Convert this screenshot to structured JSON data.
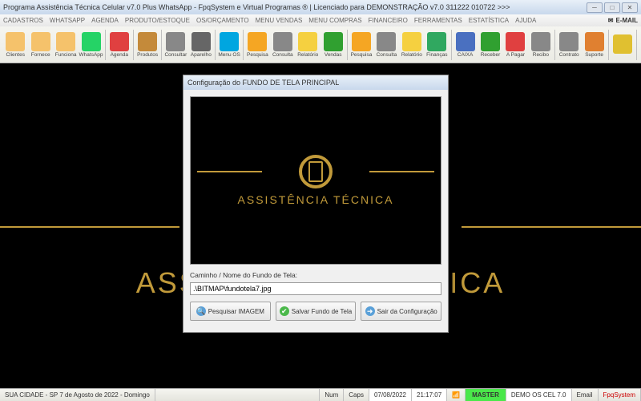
{
  "title": "Programa Assistência Técnica Celular v7.0 Plus WhatsApp - FpqSystem e Virtual Programas ® | Licenciado para  DEMONSTRAÇÃO v7.0 311222 010722  >>>",
  "menu": [
    "CADASTROS",
    "WHATSAPP",
    "AGENDA",
    "PRODUTO/ESTOQUE",
    "OS/ORÇAMENTO",
    "MENU VENDAS",
    "MENU COMPRAS",
    "FINANCEIRO",
    "FERRAMENTAS",
    "ESTATÍSTICA",
    "AJUDA"
  ],
  "email_label": "E-MAIL",
  "toolbar": [
    {
      "label": "Clientes",
      "name": "clientes",
      "color": "#f5c26b"
    },
    {
      "label": "Fornece",
      "name": "fornecedores",
      "color": "#f5c26b"
    },
    {
      "label": "Funciona",
      "name": "funcionarios",
      "color": "#f5c26b"
    },
    {
      "label": "WhatsApp",
      "name": "whatsapp",
      "color": "#25d366"
    },
    {
      "label": "Agenda",
      "name": "agenda",
      "color": "#e04040"
    },
    {
      "label": "Produtos",
      "name": "produtos",
      "color": "#c48a3a"
    },
    {
      "label": "Consultar",
      "name": "consultar-produtos",
      "color": "#888"
    },
    {
      "label": "Aparelho",
      "name": "aparelho",
      "color": "#666"
    },
    {
      "label": "Menu OS",
      "name": "menu-os",
      "color": "#00a6e0"
    },
    {
      "label": "Pesquisa",
      "name": "pesquisa-os",
      "color": "#f5a623"
    },
    {
      "label": "Consulta",
      "name": "consulta-os",
      "color": "#888"
    },
    {
      "label": "Relatório",
      "name": "relatorio-os",
      "color": "#f5d040"
    },
    {
      "label": "Vendas",
      "name": "vendas",
      "color": "#30a030"
    },
    {
      "label": "Pesquisa",
      "name": "pesquisa-vendas",
      "color": "#f5a623"
    },
    {
      "label": "Consulta",
      "name": "consulta-vendas",
      "color": "#888"
    },
    {
      "label": "Relatório",
      "name": "relatorio-vendas",
      "color": "#f5d040"
    },
    {
      "label": "Finanças",
      "name": "financas",
      "color": "#30a860"
    },
    {
      "label": "CAIXA",
      "name": "caixa",
      "color": "#4a70c0"
    },
    {
      "label": "Receber",
      "name": "receber",
      "color": "#30a030"
    },
    {
      "label": "A Pagar",
      "name": "a-pagar",
      "color": "#e04040"
    },
    {
      "label": "Recibo",
      "name": "recibo",
      "color": "#888"
    },
    {
      "label": "Contrato",
      "name": "contrato",
      "color": "#888"
    },
    {
      "label": "Suporte",
      "name": "suporte",
      "color": "#e08030"
    },
    {
      "label": "",
      "name": "sair",
      "color": "#e0c030"
    }
  ],
  "bg_text": "ASSISTÊNCIA TÉCNICA",
  "dialog": {
    "title": "Configuração do FUNDO DE TELA PRINCIPAL",
    "preview_text": "ASSISTÊNCIA TÉCNICA",
    "field_label": "Caminho / Nome do Fundo de Tela:",
    "field_value": ".\\BITMAP\\fundotela7.jpg",
    "btn_search": "Pesquisar IMAGEM",
    "btn_save": "Salvar Fundo de Tela",
    "btn_exit": "Sair da Configuração"
  },
  "status": {
    "location": "SUA CIDADE - SP  7 de Agosto de 2022 - Domingo",
    "num": "Num",
    "caps": "Caps",
    "date": "07/08/2022",
    "time": "21:17:07",
    "master": "MASTER",
    "version": "DEMO OS CEL 7.0",
    "email": "Email",
    "brand": "FpqSystem"
  },
  "colors": {
    "gold": "#c19a3a"
  }
}
